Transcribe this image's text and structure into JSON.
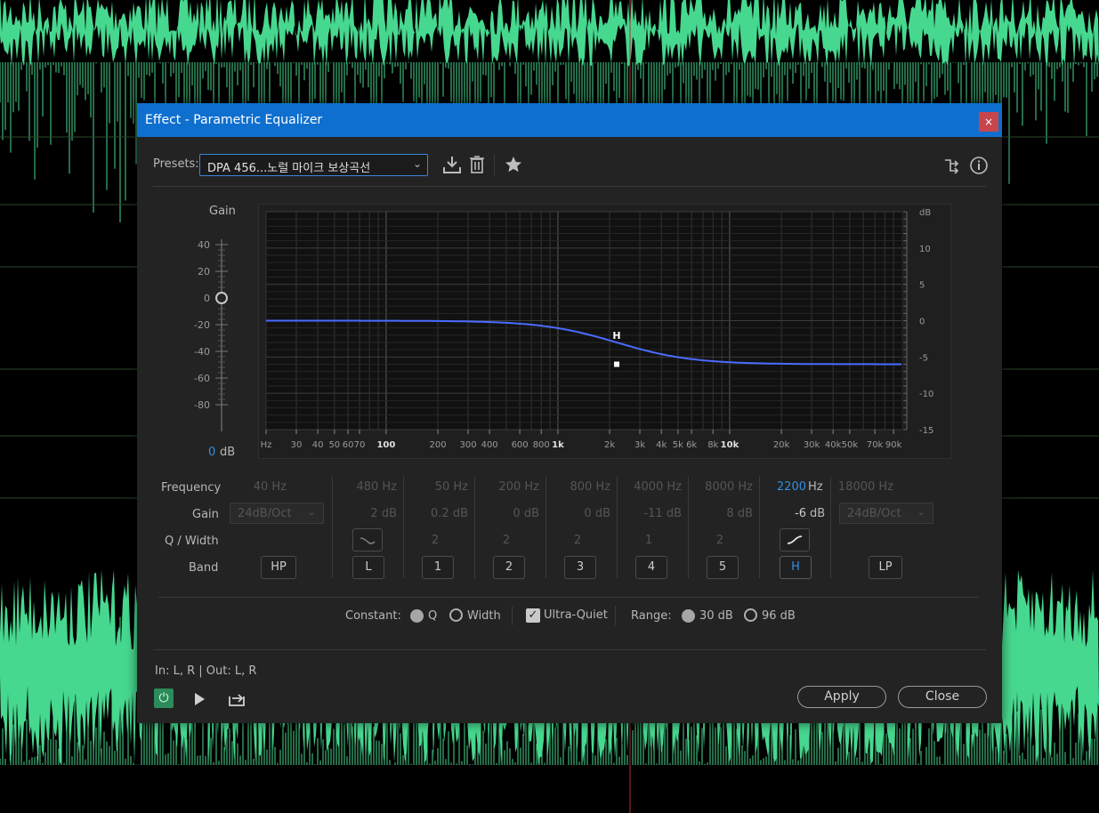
{
  "window": {
    "title": "Effect - Parametric Equalizer",
    "close_glyph": "×"
  },
  "presets": {
    "label": "Presets:",
    "value": "DPA 456...노럴 마이크 보상곡선",
    "save_icon": "download-icon",
    "delete_icon": "trash-icon",
    "favorite_icon": "star-icon",
    "routing_icon": "routing-icon",
    "info_icon": "info-icon"
  },
  "gain": {
    "label": "Gain",
    "ticks": [
      "40",
      "20",
      "0",
      "-20",
      "-40",
      "-60",
      "-80"
    ],
    "value": "0",
    "unit": "dB"
  },
  "graph": {
    "freq_ticks": [
      "Hz",
      "30",
      "40",
      "50",
      "60",
      "70",
      "100",
      "200",
      "300",
      "400",
      "600",
      "800",
      "1k",
      "2k",
      "3k",
      "4k",
      "5k",
      "6k",
      "8k",
      "10k",
      "20k",
      "30k",
      "40k",
      "50k",
      "70k",
      "90k"
    ],
    "db_ticks": [
      "dB",
      "10",
      "5",
      "0",
      "-5",
      "-10",
      "-15"
    ],
    "handle_label": "H",
    "curve_color": "#4a6cff",
    "highshelf": {
      "freq_hz": 2200,
      "gain_db": -6
    },
    "db_range": [
      -15,
      15
    ]
  },
  "params": {
    "frequency_label": "Frequency",
    "gain_label": "Gain",
    "q_label": "Q / Width",
    "band_label": "Band",
    "hz": "Hz",
    "db": "dB",
    "hp": {
      "freq": "40 Hz",
      "slope": "24dB/Oct",
      "band": "HP"
    },
    "low": {
      "freq": "480 Hz",
      "gain": "2 dB",
      "band": "L"
    },
    "bands": [
      {
        "freq": "50 Hz",
        "gain": "0.2 dB",
        "q": "2",
        "band": "1"
      },
      {
        "freq": "200 Hz",
        "gain": "0 dB",
        "q": "2",
        "band": "2"
      },
      {
        "freq": "800 Hz",
        "gain": "0 dB",
        "q": "2",
        "band": "3"
      },
      {
        "freq": "4000 Hz",
        "gain": "-11 dB",
        "q": "1",
        "band": "4"
      },
      {
        "freq": "8000 Hz",
        "gain": "8 dB",
        "q": "2",
        "band": "5"
      }
    ],
    "high": {
      "freq_value": "2200",
      "gain_value": "-6",
      "band": "H"
    },
    "lp": {
      "freq": "18000 Hz",
      "slope": "24dB/Oct",
      "band": "LP"
    }
  },
  "options": {
    "constant_label": "Constant:",
    "q": "Q",
    "width": "Width",
    "ultra_quiet": "Ultra-Quiet",
    "range_label": "Range:",
    "r30": "30 dB",
    "r96": "96 dB"
  },
  "footer": {
    "io": "In: L, R | Out: L, R",
    "apply": "Apply",
    "close": "Close"
  },
  "colors": {
    "waveform": "#47d88f",
    "titlebar": "#0f6fcf",
    "accent": "#2f8ee3"
  }
}
